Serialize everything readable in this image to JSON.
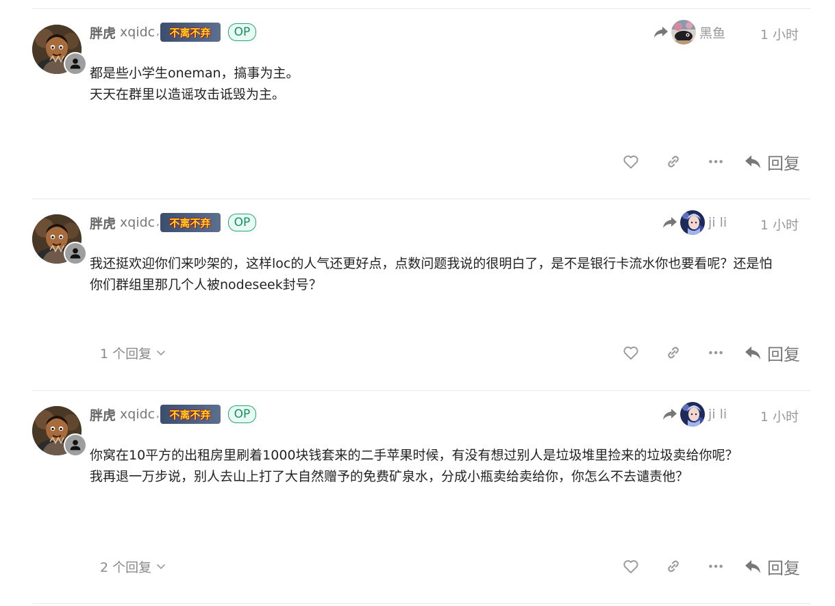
{
  "posts": [
    {
      "username": "胖虎",
      "full_name": "xqidc",
      "title_badge": "不离不弃",
      "op_badge": "OP",
      "reply_to_name": "黑鱼",
      "date": "1 小时",
      "body": [
        "都是些小学生oneman，搞事为主。",
        "天天在群里以造谣攻击诋毁为主。"
      ],
      "replies_count": "",
      "reply_label": "回复"
    },
    {
      "username": "胖虎",
      "full_name": "xqidc",
      "title_badge": "不离不弃",
      "op_badge": "OP",
      "reply_to_name": "ji li",
      "date": "1 小时",
      "body": [
        "我还挺欢迎你们来吵架的，这样loc的人气还更好点，点数问题我说的很明白了，是不是银行卡流水你也要看呢？还是怕你们群组里那几个人被nodeseek封号？"
      ],
      "replies_count": "1 个回复",
      "reply_label": "回复"
    },
    {
      "username": "胖虎",
      "full_name": "xqidc",
      "title_badge": "不离不弃",
      "op_badge": "OP",
      "reply_to_name": "ji li",
      "date": "1 小时",
      "body": [
        "你窝在10平方的出租房里刷着1000块钱套来的二手苹果时候，有没有想过别人是垃圾堆里捡来的垃圾卖给你呢？",
        "我再退一万步说，别人去山上打了大自然赠予的免费矿泉水，分成小瓶卖给卖给你，你怎么不去谴责他？"
      ],
      "replies_count": "2 个回复",
      "reply_label": "回复"
    }
  ],
  "icons": {
    "like": "heart-icon",
    "link": "link-icon",
    "more": "ellipsis-icon",
    "reply": "reply-icon",
    "reply_to": "share-arrow-icon",
    "expand": "chevron-down-icon",
    "flair": "user-icon"
  },
  "colors": {
    "op_border": "#22a574",
    "badge_text": "#ffd928",
    "muted": "#999999"
  }
}
